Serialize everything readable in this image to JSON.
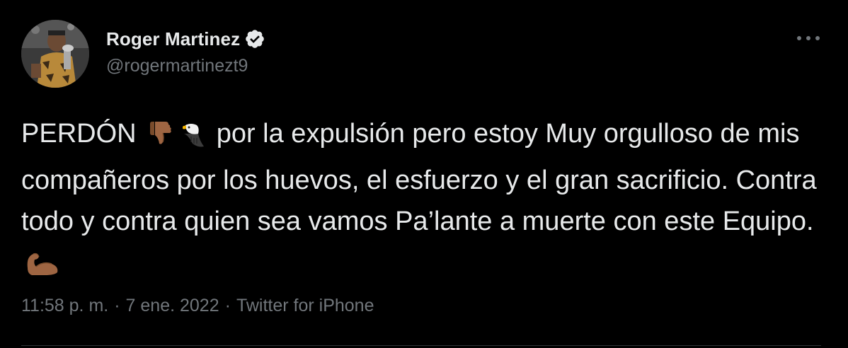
{
  "user": {
    "display_name": "Roger Martinez",
    "handle": "@rogermartinezt9",
    "verified": true
  },
  "icons": {
    "verified": "verified-badge-icon",
    "more": "more-horizontal-icon",
    "avatar": "profile-photo"
  },
  "tweet": {
    "text_parts": {
      "p1": "PERDÓN ",
      "p2": " por la expulsión pero estoy Muy orgulloso de mis compañeros por los huevos, el esfuerzo y el gran sacrificio. Contra todo y contra quien sea vamos Pa’lante a muerte con este Equipo. "
    },
    "emojis": [
      "thumbs-down-medium-dark-skin",
      "eagle",
      "flexed-biceps-medium-dark-skin"
    ]
  },
  "meta": {
    "time": "11:58 p. m.",
    "separator": "·",
    "date": "7 ene. 2022",
    "source": "Twitter for iPhone"
  },
  "colors": {
    "background": "#000000",
    "text": "#e7e9ea",
    "secondary": "#71767b",
    "divider": "#2f3336",
    "verified_fill": "#e7e9ea"
  }
}
